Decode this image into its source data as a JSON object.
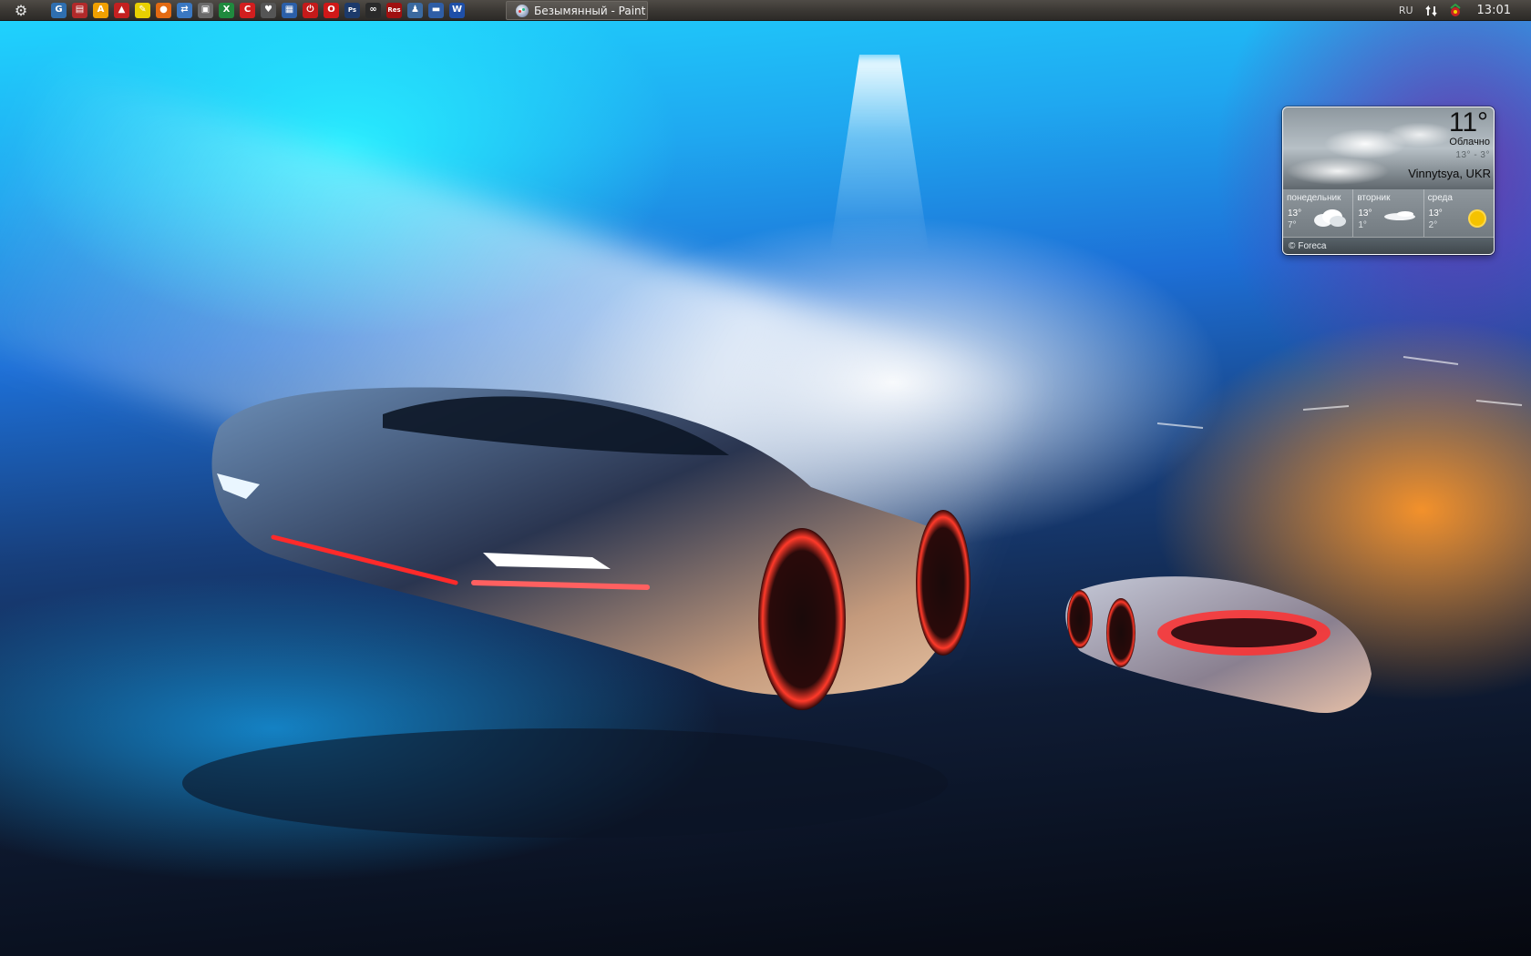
{
  "taskbar": {
    "start_icon": "gear-start-icon",
    "quick_launch": [
      {
        "name": "g-app-icon",
        "glyph": "G",
        "bg": "#2f6fb0"
      },
      {
        "name": "pdf-icon",
        "glyph": "▤",
        "bg": "#b22a2a"
      },
      {
        "name": "avast-icon",
        "glyph": "A",
        "bg": "#f0a000"
      },
      {
        "name": "red-car-icon",
        "glyph": "▲",
        "bg": "#c42020"
      },
      {
        "name": "pencil-icon",
        "glyph": "✎",
        "bg": "#e8d000"
      },
      {
        "name": "firefox-icon",
        "glyph": "●",
        "bg": "#e36a12"
      },
      {
        "name": "network-icon",
        "glyph": "⇄",
        "bg": "#3a78c2"
      },
      {
        "name": "settings-window-icon",
        "glyph": "▣",
        "bg": "#6a6a6a"
      },
      {
        "name": "excel-icon",
        "glyph": "X",
        "bg": "#1f8a3e"
      },
      {
        "name": "red-c-icon",
        "glyph": "C",
        "bg": "#d21e1e"
      },
      {
        "name": "shield-icon",
        "glyph": "♥",
        "bg": "#555"
      },
      {
        "name": "photos-icon",
        "glyph": "▦",
        "bg": "#2b5fa8"
      },
      {
        "name": "power-icon",
        "glyph": "⏻",
        "bg": "#c41a1a"
      },
      {
        "name": "opera-icon",
        "glyph": "O",
        "bg": "#d01818"
      },
      {
        "name": "photoshop-icon",
        "glyph": "Ps",
        "bg": "#1c3a6b"
      },
      {
        "name": "infinity-icon",
        "glyph": "∞",
        "bg": "#2a2a2a"
      },
      {
        "name": "res-icon",
        "glyph": "Res",
        "bg": "#a01010"
      },
      {
        "name": "robot-icon",
        "glyph": "♟",
        "bg": "#3b6aa0"
      },
      {
        "name": "disk-save-icon",
        "glyph": "▬",
        "bg": "#2f5ea6"
      },
      {
        "name": "word-icon",
        "glyph": "W",
        "bg": "#1e4fa8"
      }
    ],
    "task": {
      "label": "Безымянный - Paint",
      "icon": "paint-icon"
    },
    "tray": {
      "language": "RU",
      "network_icon": "network-arrows-icon",
      "antivirus_icon": "antivirus-icon",
      "clock": "13:01"
    }
  },
  "weather": {
    "temperature": "11°",
    "condition": "Облачно",
    "range": "13° - 3°",
    "location": "Vinnytsya, UKR",
    "forecast": [
      {
        "day": "понедельник",
        "high": "13°",
        "low": "7°",
        "icon": "cloud-icon"
      },
      {
        "day": "вторник",
        "high": "13°",
        "low": "1°",
        "icon": "thin-cloud-icon"
      },
      {
        "day": "среда",
        "high": "13°",
        "low": "2°",
        "icon": "sun-icon"
      }
    ],
    "provider": "Foreca",
    "colors": {
      "sun": "#f5c200"
    }
  }
}
